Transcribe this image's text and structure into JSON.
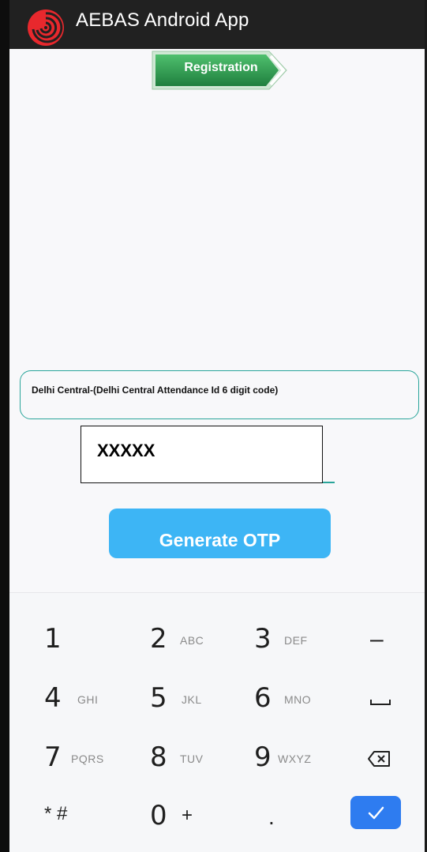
{
  "app": {
    "title": "AEBAS Android App",
    "logo_icon": "spiral-logo-icon"
  },
  "registration": {
    "badge_label": "Registration"
  },
  "form": {
    "unit_text": "Delhi Central-(Delhi Central Attendance Id 6 digit code)",
    "attendance_id_value": "XXXXX",
    "generate_button_label": "Generate OTP"
  },
  "keypad": {
    "keys": [
      {
        "digit": "1",
        "letters": ""
      },
      {
        "digit": "2",
        "letters": "ABC"
      },
      {
        "digit": "3",
        "letters": "DEF"
      },
      {
        "digit": "4",
        "letters": "GHI"
      },
      {
        "digit": "5",
        "letters": "JKL"
      },
      {
        "digit": "6",
        "letters": "MNO"
      },
      {
        "digit": "7",
        "letters": "PQRS"
      },
      {
        "digit": "8",
        "letters": "TUV"
      },
      {
        "digit": "9",
        "letters": "WXYZ"
      },
      {
        "digit": "0",
        "letters": "+"
      }
    ],
    "star_hash": "* #",
    "dot": ".",
    "minus": "–"
  },
  "colors": {
    "title_bar": "#212121",
    "badge_green": "#2e9a4f",
    "accent_teal": "#2aa59a",
    "button_blue": "#3db5f5",
    "done_blue": "#2e7cf0"
  }
}
